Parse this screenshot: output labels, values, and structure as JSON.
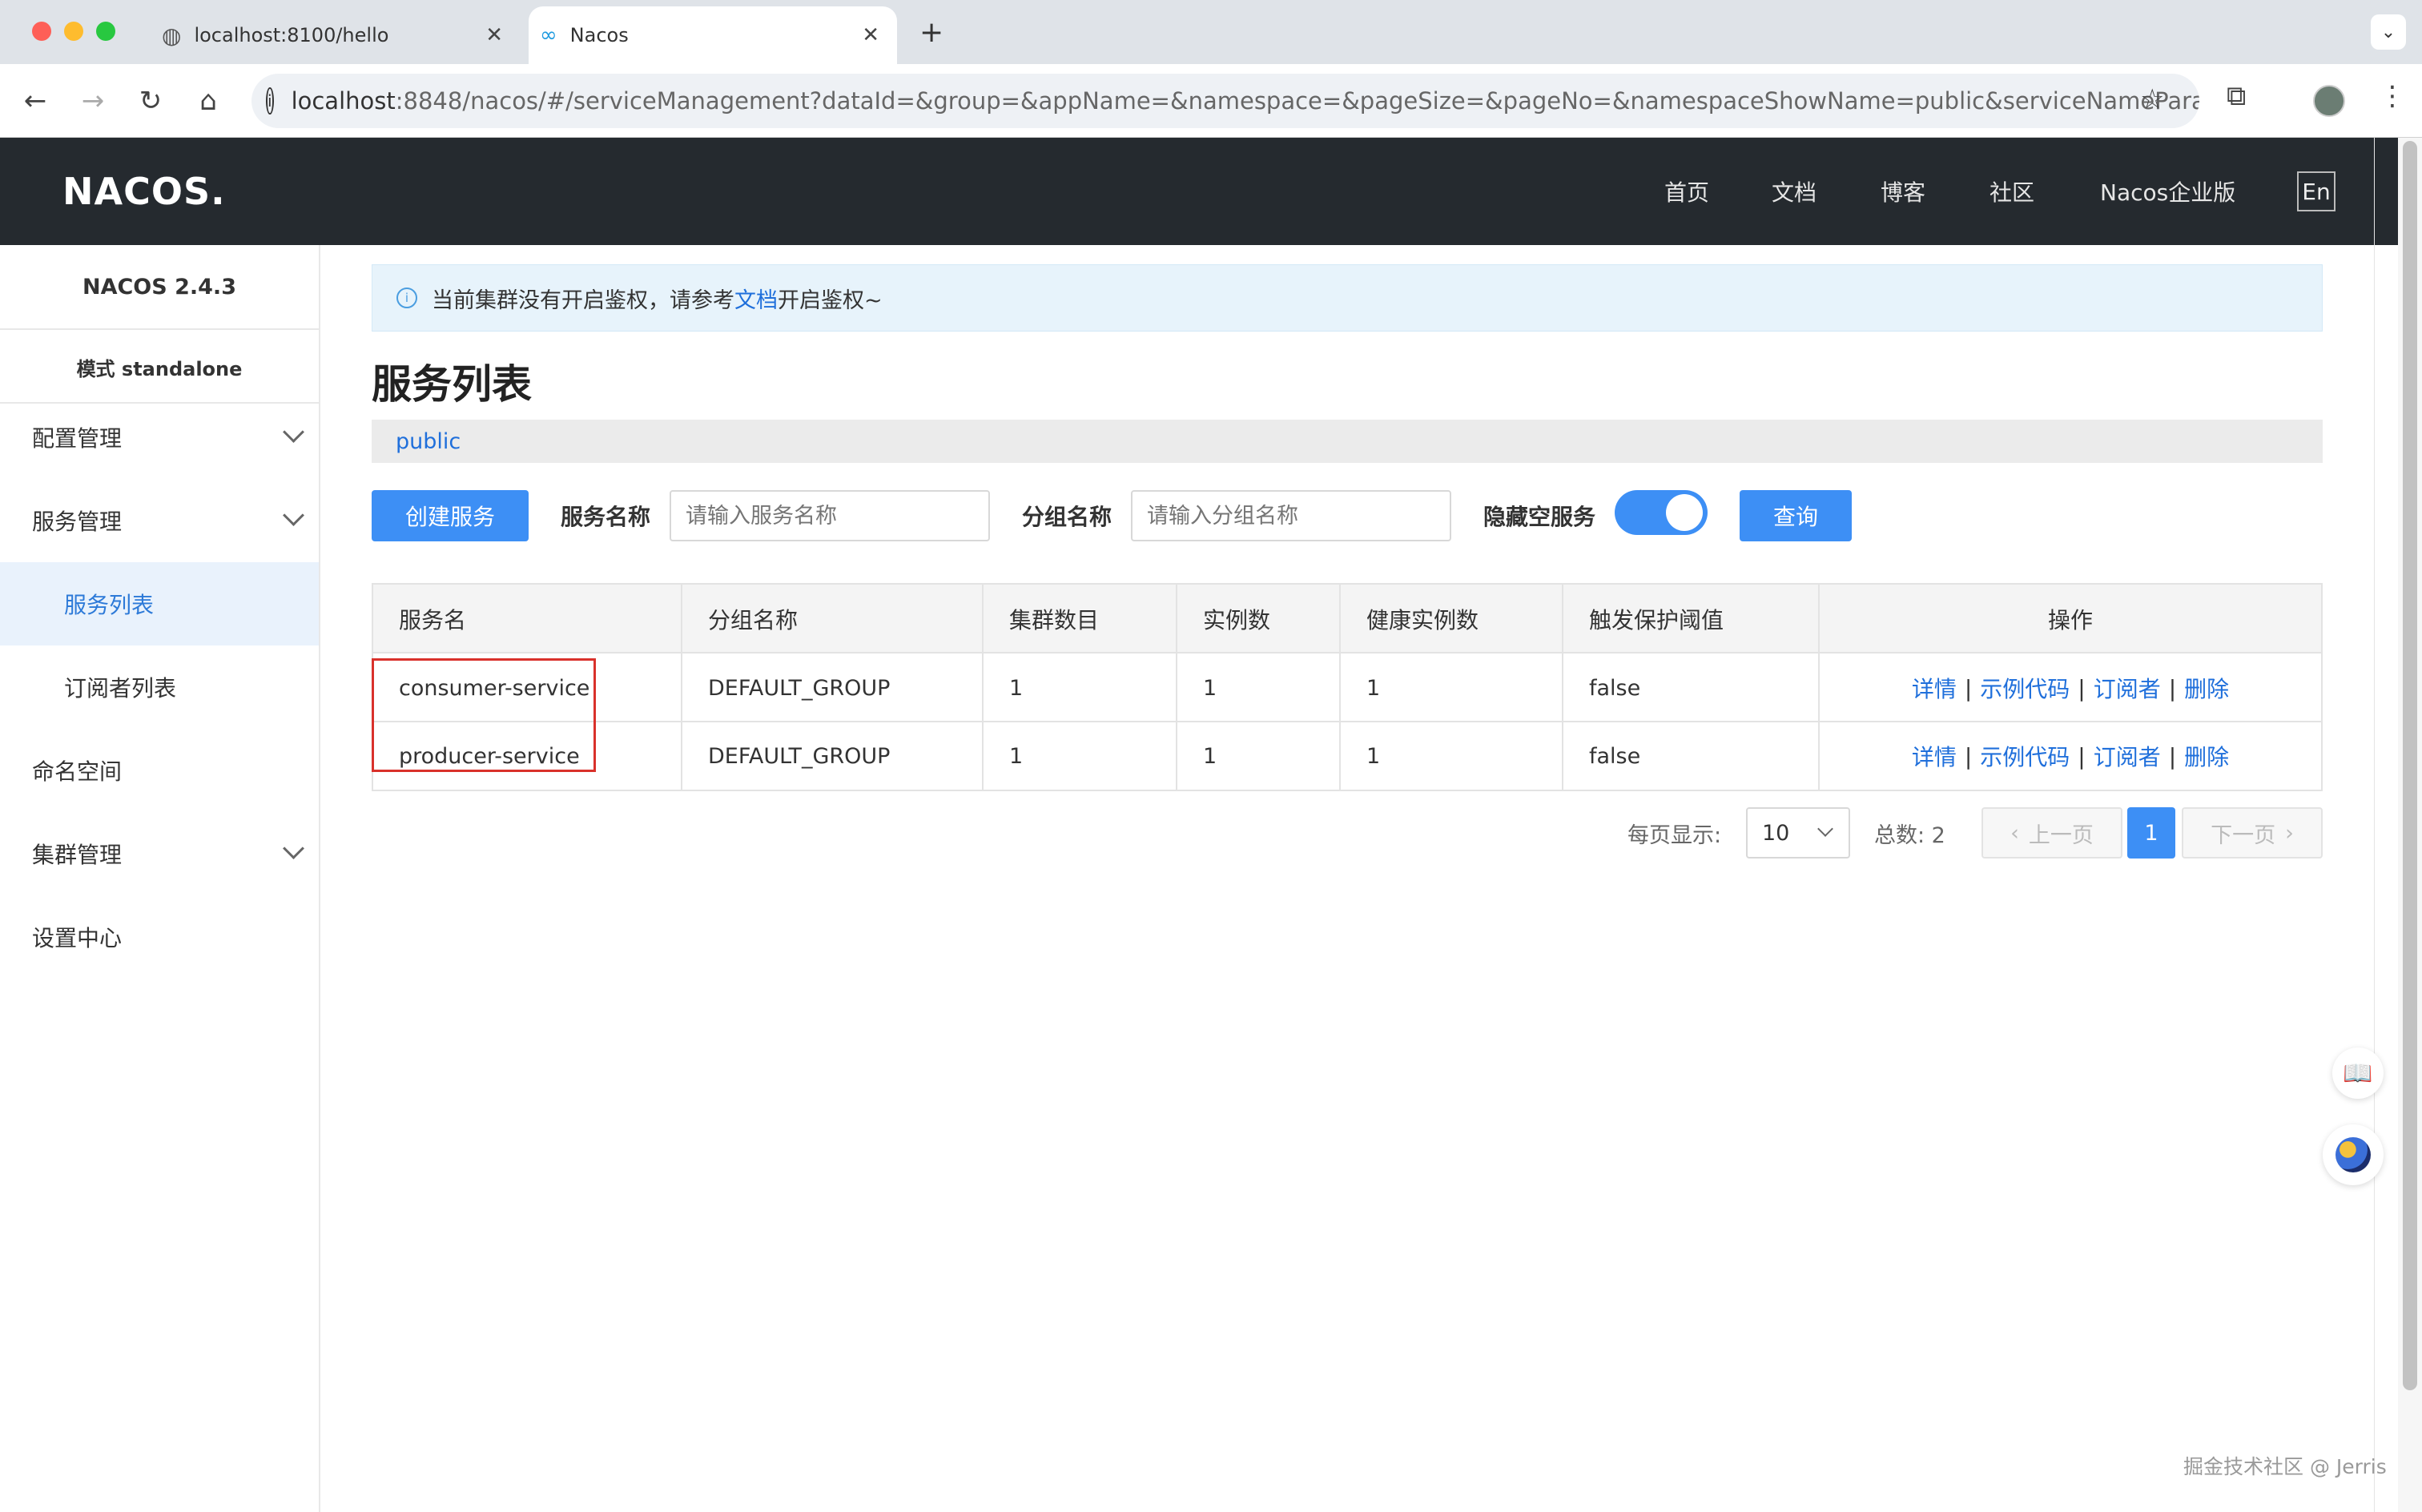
{
  "browser": {
    "tabs": [
      {
        "title": "localhost:8100/hello"
      },
      {
        "title": "Nacos"
      }
    ],
    "url_host": "localhost",
    "url_rest": ":8848/nacos/#/serviceManagement?dataId=&group=&appName=&namespace=&pageSize=&pageNo=&namespaceShowName=public&serviceNameParam=&gro..."
  },
  "header": {
    "logo": "NACOS.",
    "nav": [
      "首页",
      "文档",
      "博客",
      "社区",
      "Nacos企业版"
    ],
    "lang_button": "En"
  },
  "sidebar": {
    "version": "NACOS 2.4.3",
    "mode": "模式 standalone",
    "items": [
      {
        "label": "配置管理"
      },
      {
        "label": "服务管理"
      },
      {
        "label": "服务列表"
      },
      {
        "label": "订阅者列表"
      },
      {
        "label": "命名空间"
      },
      {
        "label": "集群管理"
      },
      {
        "label": "设置中心"
      }
    ]
  },
  "notice": {
    "before": "当前集群没有开启鉴权，请参考",
    "link": "文档",
    "after": "开启鉴权~"
  },
  "page": {
    "title": "服务列表",
    "namespace": "public"
  },
  "filters": {
    "create_button": "创建服务",
    "service_name_label": "服务名称",
    "service_name_placeholder": "请输入服务名称",
    "group_name_label": "分组名称",
    "group_name_placeholder": "请输入分组名称",
    "hide_empty_label": "隐藏空服务",
    "hide_empty_on": true,
    "query_button": "查询"
  },
  "table": {
    "columns": [
      "服务名",
      "分组名称",
      "集群数目",
      "实例数",
      "健康实例数",
      "触发保护阈值",
      "操作"
    ],
    "rows": [
      {
        "name": "consumer-service",
        "group": "DEFAULT_GROUP",
        "clusters": "1",
        "instances": "1",
        "healthy": "1",
        "protect": "false"
      },
      {
        "name": "producer-service",
        "group": "DEFAULT_GROUP",
        "clusters": "1",
        "instances": "1",
        "healthy": "1",
        "protect": "false"
      }
    ],
    "actions": [
      "详情",
      "示例代码",
      "订阅者",
      "删除"
    ],
    "action_separator": "|"
  },
  "pagination": {
    "page_size_label": "每页显示:",
    "page_size": "10",
    "total_label": "总数: 2",
    "prev": "上一页",
    "current": "1",
    "next": "下一页"
  },
  "watermark": "掘金技术社区 @ Jerris",
  "colors": {
    "header_bg": "#252a2f",
    "primary": "#3d8ff5",
    "link": "#1f6fdb",
    "highlight_box": "#d9312b"
  }
}
